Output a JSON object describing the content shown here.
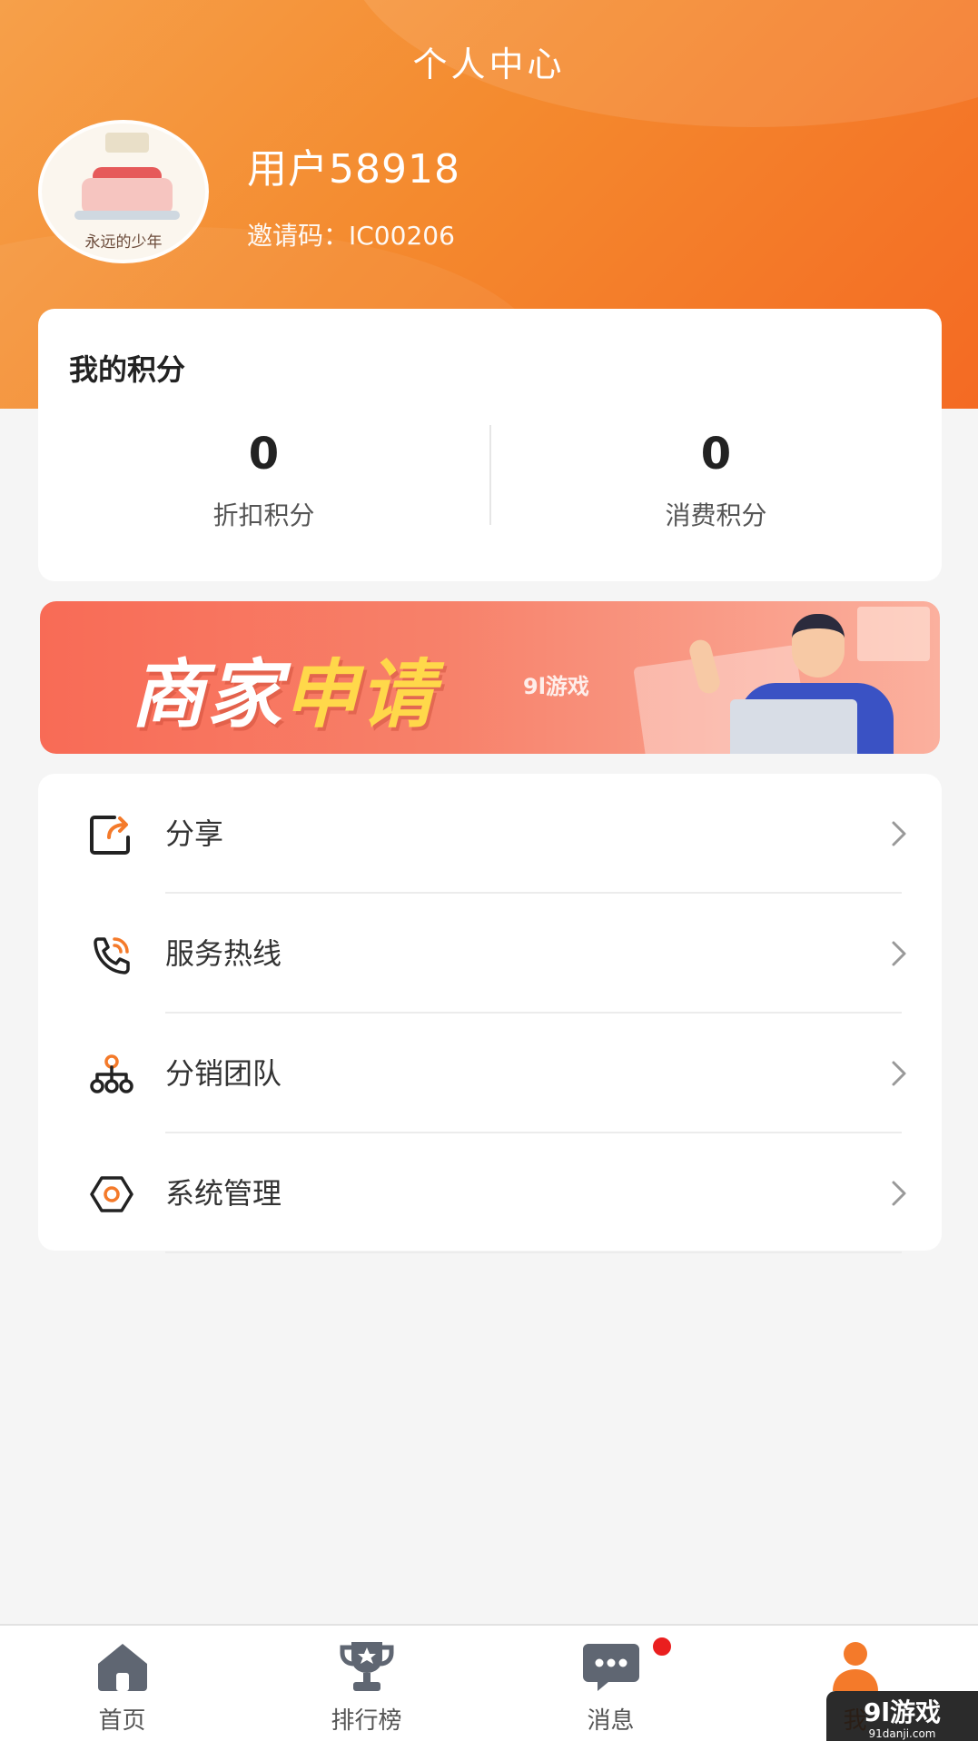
{
  "header": {
    "title": "个人中心",
    "avatar_caption": "永远的少年",
    "username": "用户58918",
    "invite_code": "邀请码：IC00206"
  },
  "points": {
    "title": "我的积分",
    "discount": {
      "value": "0",
      "label": "折扣积分"
    },
    "consume": {
      "value": "0",
      "label": "消费积分"
    }
  },
  "banner": {
    "text_part1": "商家",
    "text_part2": "申请",
    "logo": "9l游戏"
  },
  "menu": {
    "items": [
      {
        "label": "分享",
        "icon": "share-icon"
      },
      {
        "label": "服务热线",
        "icon": "phone-icon"
      },
      {
        "label": "分销团队",
        "icon": "team-icon"
      },
      {
        "label": "系统管理",
        "icon": "settings-icon"
      }
    ]
  },
  "tabbar": {
    "items": [
      {
        "label": "首页",
        "icon": "home-icon"
      },
      {
        "label": "排行榜",
        "icon": "trophy-icon"
      },
      {
        "label": "消息",
        "icon": "message-icon"
      },
      {
        "label": "我",
        "icon": "user-icon"
      }
    ],
    "active_index": 3
  },
  "watermark": {
    "title": "9l游戏",
    "sub": "91danji.com"
  },
  "colors": {
    "accent": "#f47a2a",
    "header_start": "#f6a04a",
    "header_end": "#f46a23",
    "badge": "#ea1f1f"
  }
}
